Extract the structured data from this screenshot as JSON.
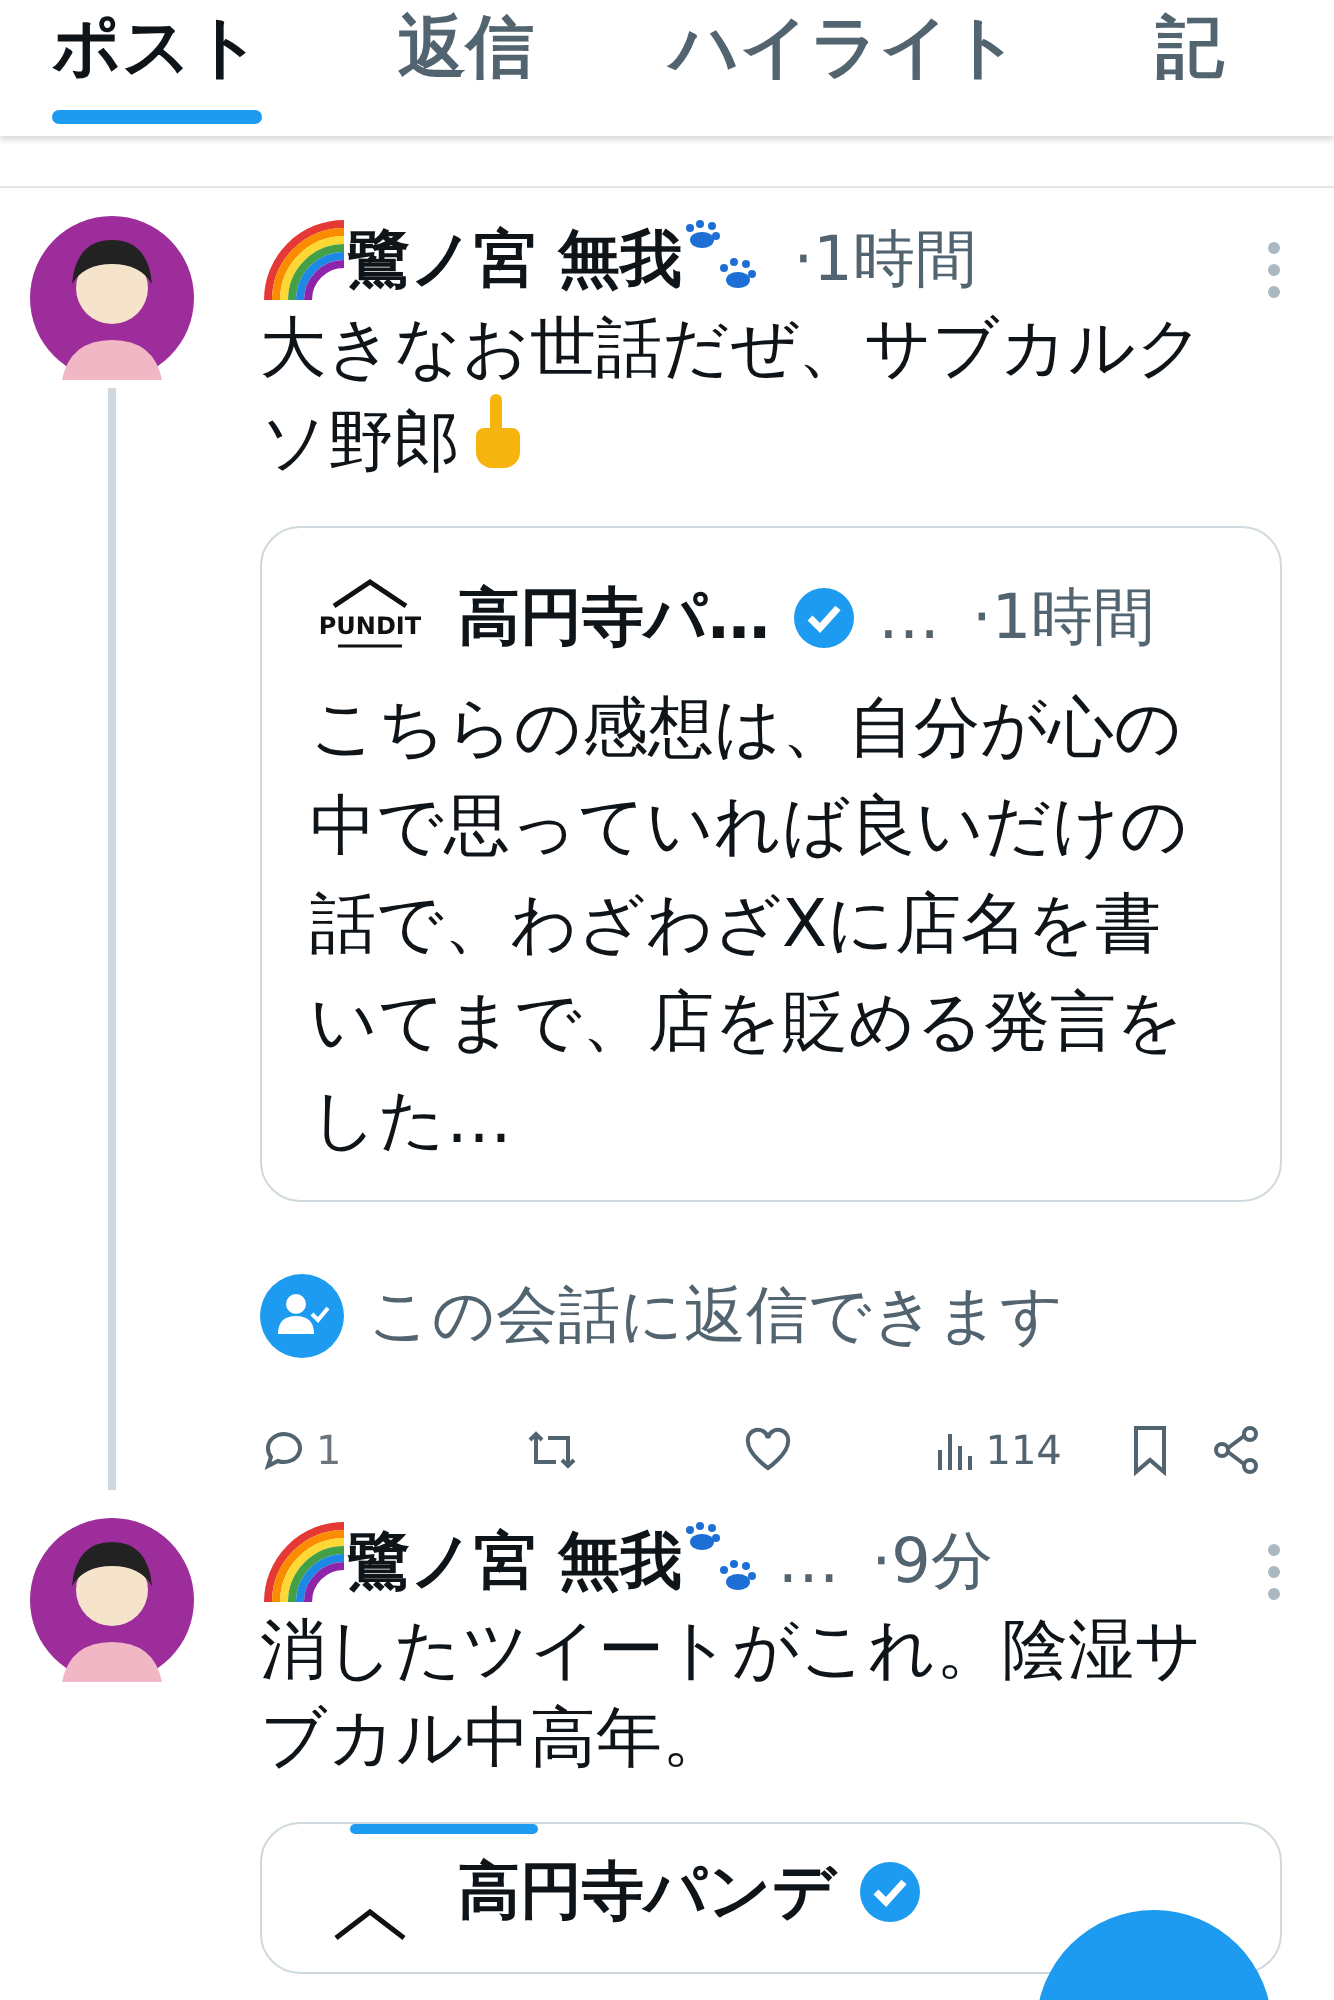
{
  "tabs": [
    {
      "label": "ポスト",
      "selected": true
    },
    {
      "label": "返信",
      "selected": false
    },
    {
      "label": "ハイライト",
      "selected": false
    },
    {
      "label": "記",
      "selected": false
    }
  ],
  "posts": [
    {
      "kind": "with_emoji",
      "author": "鷺ノ宮 無我",
      "time": "·1時間",
      "text": "大きなお世話だぜ、サブカルクソ野郎",
      "thread_line": true,
      "quote": {
        "logo_text": "PUNDIT",
        "author": "高円寺パ…",
        "verified": true,
        "handle": "…",
        "time": "·1時間",
        "text": "こちらの感想は、自分が心の中で思っていれば良いだけの話で、わざわざXに店名を書いてまで、店を貶める発言をした…"
      },
      "reply_notice": "この会話に返信できます",
      "actions": {
        "replies": "1",
        "views": "114"
      }
    },
    {
      "kind": "plain",
      "author": "鷺ノ宮 無我",
      "handle": "…",
      "time": "·9分",
      "text": "消したツイートがこれ。陰湿サブカル中高年。",
      "thread_line": false,
      "quote": {
        "author": "高円寺パンデ",
        "verified": true
      }
    }
  ]
}
